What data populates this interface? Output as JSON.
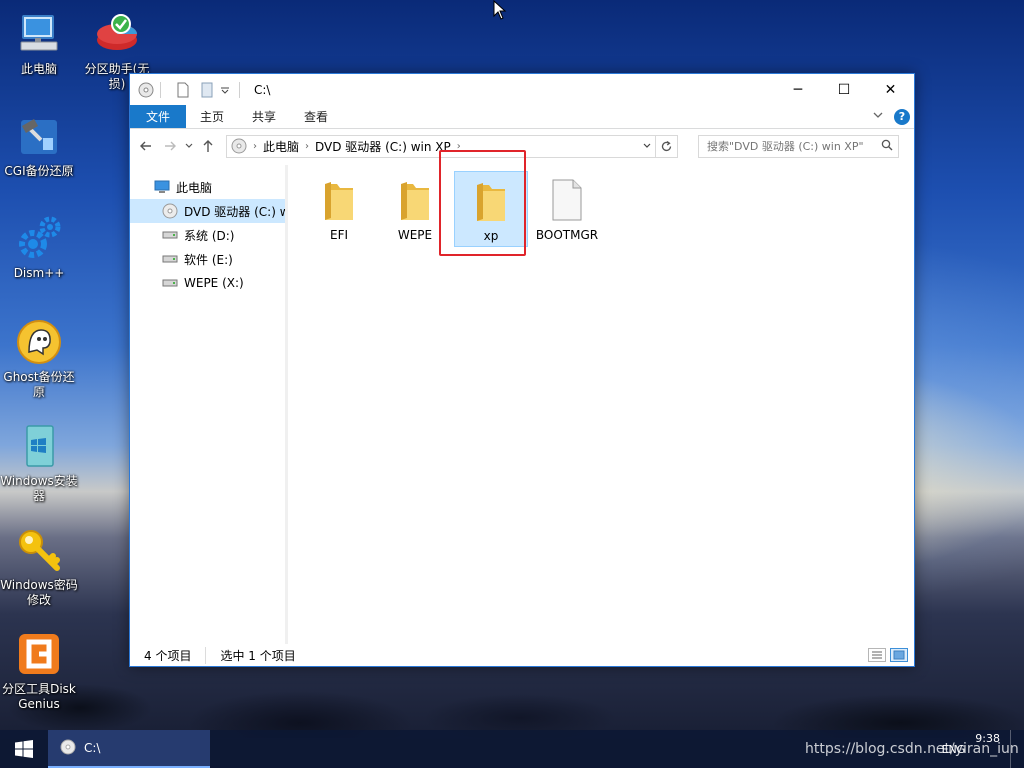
{
  "desktop": {
    "icons": [
      {
        "label": "此电脑",
        "icon": "computer-icon"
      },
      {
        "label": "分区助手(无损)",
        "icon": "partition-assistant-icon"
      },
      {
        "label": "CGI备份还原",
        "icon": "cgi-backup-icon"
      },
      {
        "label": "Dism++",
        "icon": "gear-icon"
      },
      {
        "label": "Ghost备份还原",
        "icon": "ghost-icon"
      },
      {
        "label": "Windows安装器",
        "icon": "windows-installer-icon"
      },
      {
        "label": "Windows密码修改",
        "icon": "key-icon"
      },
      {
        "label": "分区工具DiskGenius",
        "icon": "diskgenius-icon"
      }
    ]
  },
  "window": {
    "title": "C:\\",
    "controls": {
      "minimize": "─",
      "maximize": "☐",
      "close": "✕"
    },
    "ribbon_tabs": [
      "文件",
      "主页",
      "共享",
      "查看"
    ],
    "address": {
      "crumbs": [
        "此电脑",
        "DVD 驱动器 (C:) win XP"
      ],
      "separator": "›"
    },
    "search": {
      "placeholder": "搜索\"DVD 驱动器 (C:) win XP\""
    },
    "navpane": [
      {
        "label": "此电脑",
        "icon": "computer-icon",
        "indent": 0,
        "selected": false
      },
      {
        "label": "DVD 驱动器 (C:) win XP",
        "icon": "dvd-icon",
        "indent": 1,
        "selected": true
      },
      {
        "label": "系统 (D:)",
        "icon": "drive-icon",
        "indent": 1,
        "selected": false
      },
      {
        "label": "软件 (E:)",
        "icon": "drive-icon",
        "indent": 1,
        "selected": false
      },
      {
        "label": "WEPE (X:)",
        "icon": "drive-icon",
        "indent": 1,
        "selected": false
      }
    ],
    "items": [
      {
        "name": "EFI",
        "type": "folder",
        "selected": false
      },
      {
        "name": "WEPE",
        "type": "folder",
        "selected": false
      },
      {
        "name": "xp",
        "type": "folder",
        "selected": true
      },
      {
        "name": "BOOTMGR",
        "type": "file",
        "selected": false
      }
    ],
    "status": {
      "count": "4 个项目",
      "selected": "选中 1 个项目"
    }
  },
  "taskbar": {
    "task_label": "C:\\",
    "clock_time": "9:38",
    "input_lang": "ENG",
    "watermark": "https://blog.csdn.net/yiran_iun"
  },
  "colors": {
    "accent": "#1979ca",
    "selection": "#cce8ff",
    "highlight_box": "#e0242a",
    "folder": "#f3c85a"
  }
}
